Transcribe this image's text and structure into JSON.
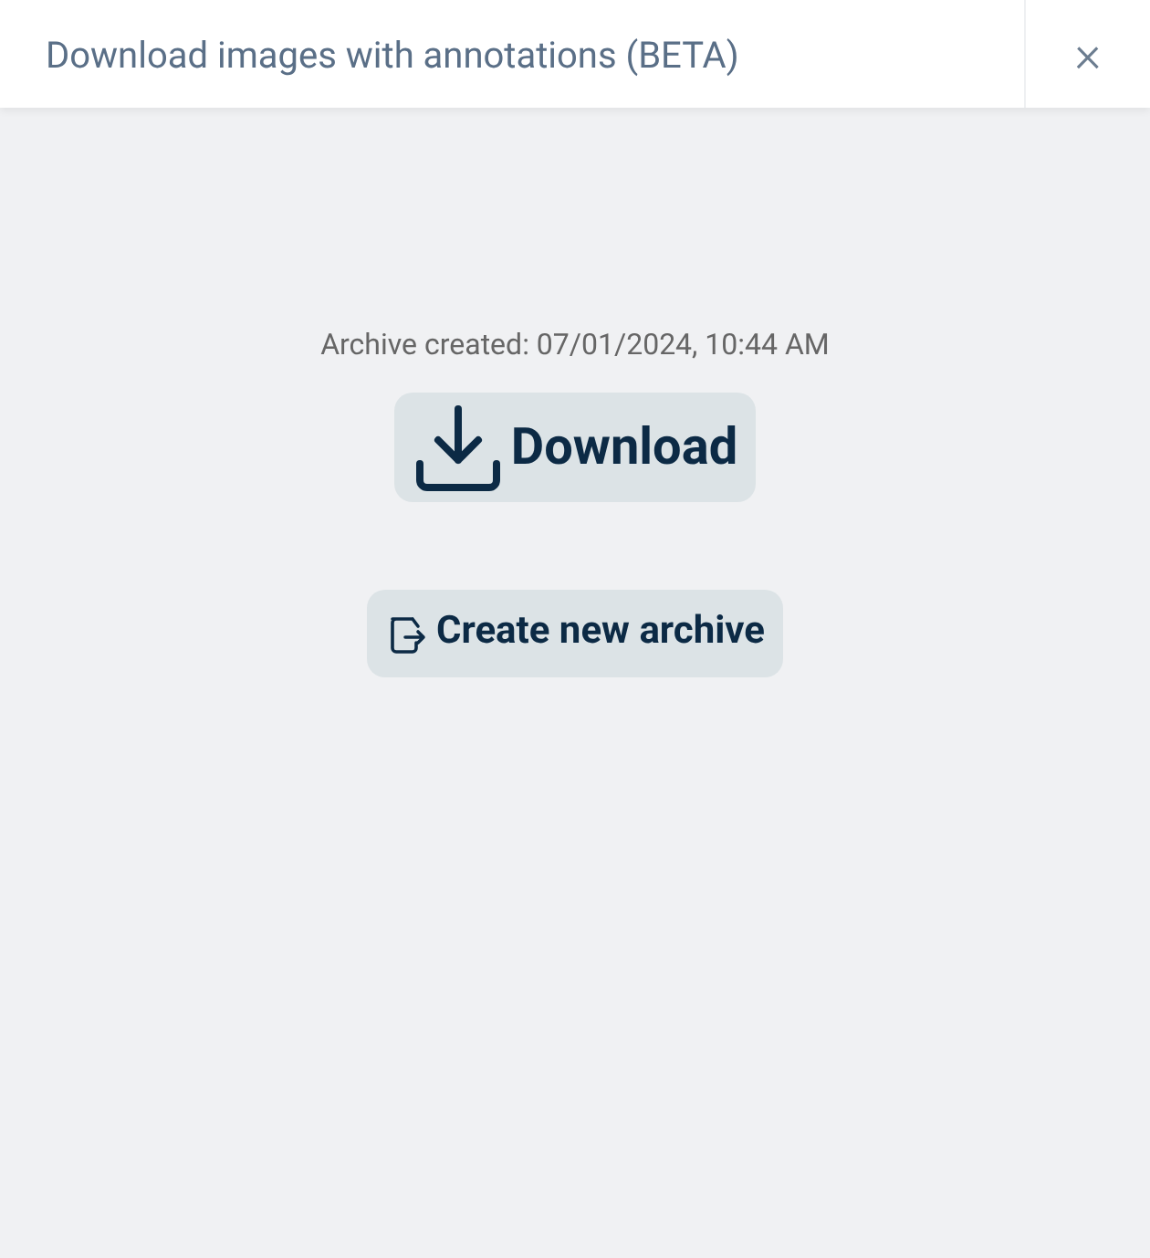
{
  "dialog": {
    "title": "Download images with annotations (BETA)",
    "close": "×"
  },
  "archive_info": "Archive created: 07/01/2024, 10:44 AM",
  "buttons": [
    {
      "kind": "download",
      "label": "Download"
    },
    {
      "kind": "create",
      "label": "Create new archive"
    }
  ]
}
